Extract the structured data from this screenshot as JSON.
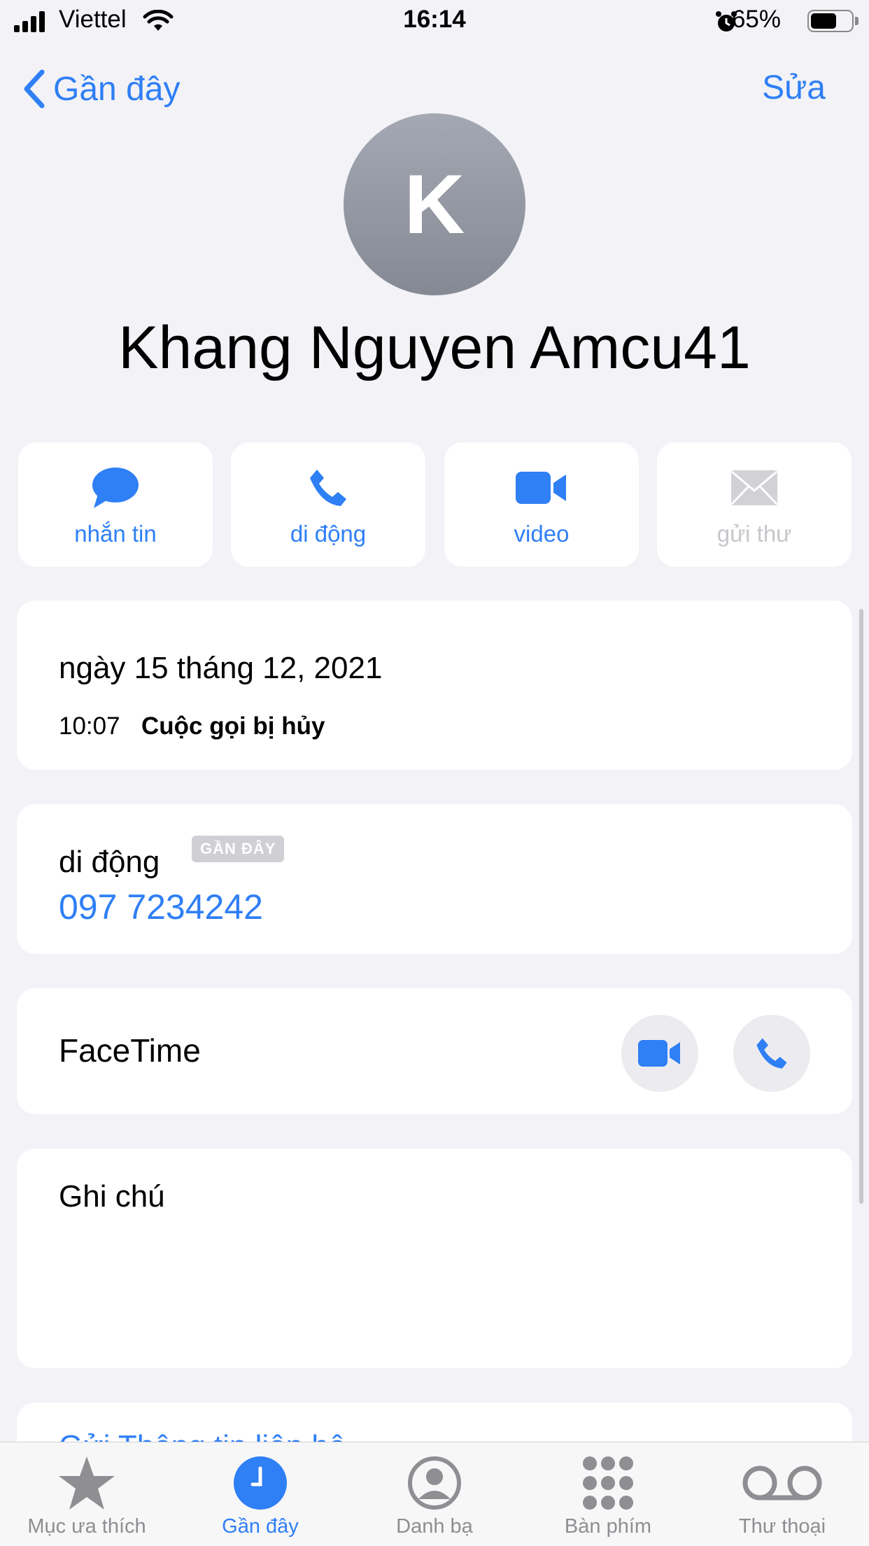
{
  "status_bar": {
    "carrier": "Viettel",
    "time": "16:14",
    "battery_percent": "65%",
    "battery_level": 0.65
  },
  "nav": {
    "back_label": "Gần đây",
    "edit_label": "Sửa"
  },
  "contact": {
    "initial": "K",
    "name": "Khang Nguyen Amcu41"
  },
  "actions": [
    {
      "label": "nhắn tin",
      "icon": "message-icon",
      "enabled": true
    },
    {
      "label": "di động",
      "icon": "phone-icon",
      "enabled": true
    },
    {
      "label": "video",
      "icon": "video-icon",
      "enabled": true
    },
    {
      "label": "gửi thư",
      "icon": "mail-icon",
      "enabled": false
    }
  ],
  "call_log": {
    "date": "ngày 15 tháng 12, 2021",
    "time": "10:07",
    "status": "Cuộc gọi bị hủy"
  },
  "phone": {
    "label": "di động",
    "badge": "GẦN ĐÂY",
    "number": "097 7234242"
  },
  "facetime": {
    "label": "FaceTime"
  },
  "notes": {
    "label": "Ghi chú"
  },
  "share_peek": {
    "label": "Gửi Thông tin liên hệ"
  },
  "tabbar": [
    {
      "label": "Mục ưa thích",
      "icon": "star-icon",
      "active": false
    },
    {
      "label": "Gần đây",
      "icon": "clock-icon",
      "active": true
    },
    {
      "label": "Danh bạ",
      "icon": "person-circle-icon",
      "active": false
    },
    {
      "label": "Bàn phím",
      "icon": "keypad-icon",
      "active": false
    },
    {
      "label": "Thư thoại",
      "icon": "voicemail-icon",
      "active": false
    }
  ],
  "colors": {
    "accent": "#2f7ff5",
    "background": "#f2f2f7",
    "card": "#ffffff",
    "inactive": "#8e8e93"
  }
}
